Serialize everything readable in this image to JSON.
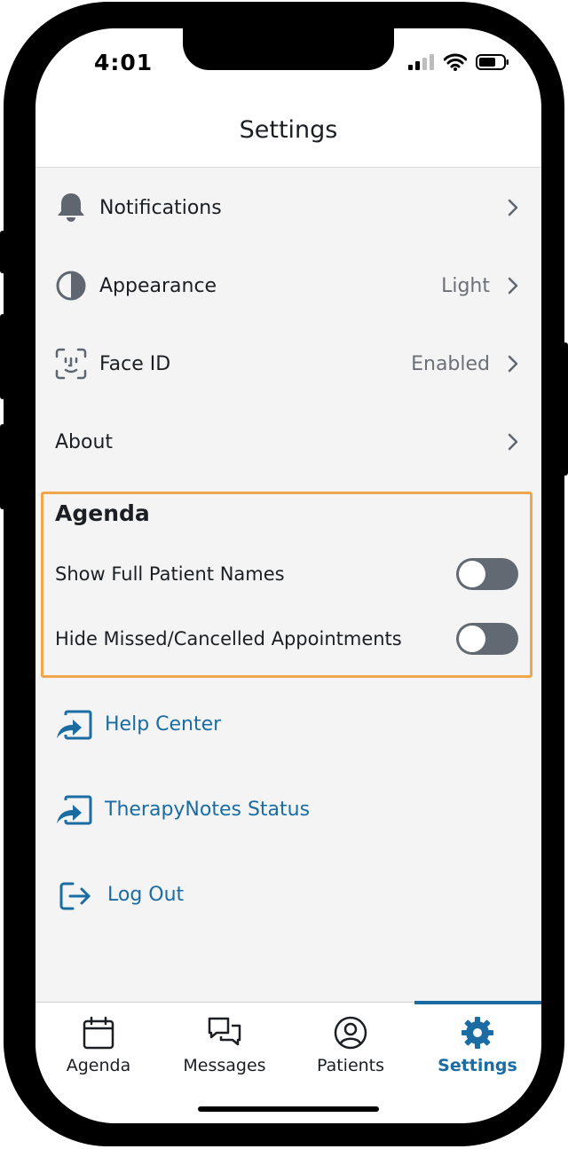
{
  "status_bar": {
    "time": "4:01"
  },
  "header": {
    "title": "Settings"
  },
  "settings": {
    "notifications": {
      "label": "Notifications",
      "icon": "bell-icon"
    },
    "appearance": {
      "label": "Appearance",
      "value": "Light",
      "icon": "contrast-icon"
    },
    "face_id": {
      "label": "Face ID",
      "value": "Enabled",
      "icon": "face-id-icon"
    },
    "about": {
      "label": "About"
    }
  },
  "agenda": {
    "title": "Agenda",
    "show_full_names": {
      "label": "Show Full Patient Names",
      "enabled": false
    },
    "hide_missed": {
      "label": "Hide Missed/Cancelled Appointments",
      "enabled": false
    }
  },
  "links": {
    "help_center": {
      "label": "Help Center",
      "icon": "external-link-icon"
    },
    "status": {
      "label": "TherapyNotes Status",
      "icon": "external-link-icon"
    },
    "logout": {
      "label": "Log Out",
      "icon": "logout-icon"
    }
  },
  "tabs": [
    {
      "label": "Agenda",
      "icon": "calendar-icon",
      "active": false
    },
    {
      "label": "Messages",
      "icon": "messages-icon",
      "active": false
    },
    {
      "label": "Patients",
      "icon": "user-circle-icon",
      "active": false
    },
    {
      "label": "Settings",
      "icon": "gear-icon",
      "active": true
    }
  ],
  "colors": {
    "accent": "#1a6ca3",
    "highlight_border": "#f0a64a",
    "toggle_off": "#616a73"
  }
}
